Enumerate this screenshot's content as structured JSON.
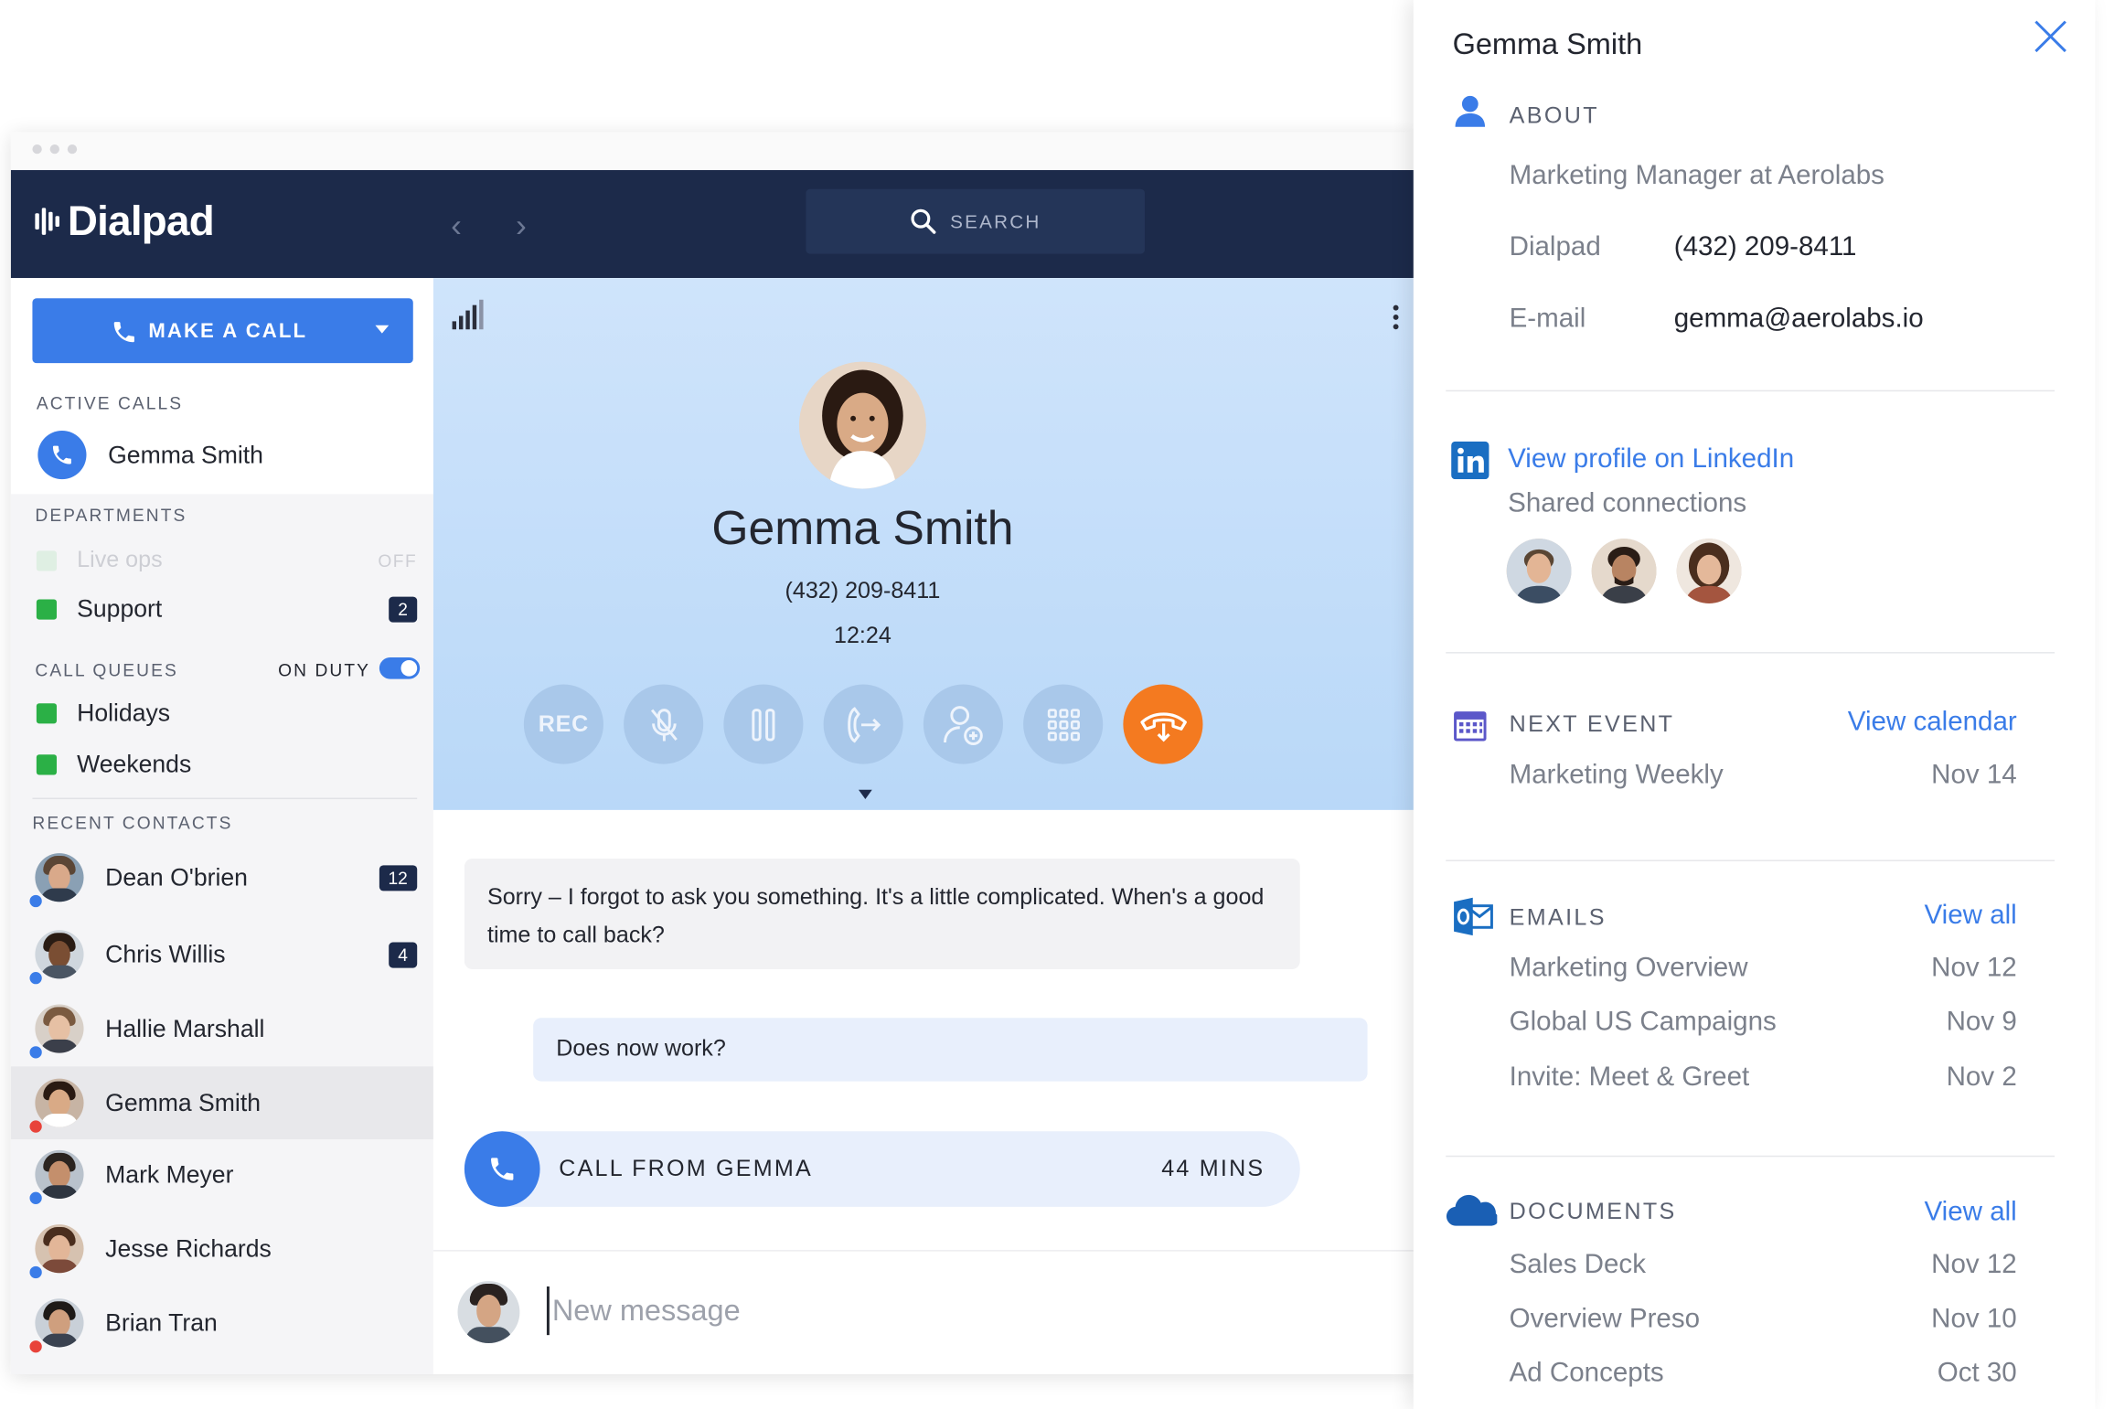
{
  "app": {
    "brand": "Dialpad",
    "search_label": "SEARCH"
  },
  "sidebar": {
    "make_call_label": "MAKE A CALL",
    "active_calls_label": "ACTIVE CALLS",
    "active_call_name": "Gemma Smith",
    "departments_label": "DEPARTMENTS",
    "departments": [
      {
        "name": "Live ops",
        "status": "OFF",
        "color": "#c6e9cc"
      },
      {
        "name": "Support",
        "badge": "2",
        "color": "#2bb046"
      }
    ],
    "call_queues_label": "CALL QUEUES",
    "on_duty_label": "ON DUTY",
    "queues": [
      {
        "name": "Holidays",
        "color": "#2bb046"
      },
      {
        "name": "Weekends",
        "color": "#2bb046"
      }
    ],
    "recent_contacts_label": "RECENT CONTACTS",
    "contacts": [
      {
        "name": "Dean O'brien",
        "badge": "12",
        "presence": "#3a7ce8"
      },
      {
        "name": "Chris Willis",
        "badge": "4",
        "presence": "#3a7ce8"
      },
      {
        "name": "Hallie Marshall",
        "badge": "",
        "presence": "#3a7ce8"
      },
      {
        "name": "Gemma Smith",
        "badge": "",
        "presence": "#e8433a"
      },
      {
        "name": "Mark Meyer",
        "badge": "",
        "presence": "#3a7ce8"
      },
      {
        "name": "Jesse Richards",
        "badge": "",
        "presence": "#3a7ce8"
      },
      {
        "name": "Brian Tran",
        "badge": "",
        "presence": "#e8433a"
      }
    ]
  },
  "call": {
    "name": "Gemma Smith",
    "number": "(432) 209-8411",
    "duration": "12:24",
    "rec_label": "REC",
    "controls": [
      "rec",
      "mute-icon",
      "hold-icon",
      "transfer-icon",
      "add-person-icon",
      "keypad-icon",
      "hangup-icon"
    ]
  },
  "conversation": {
    "message_in": "Sorry – I forgot to ask you something. It's a little complicated. When's a good time to call back?",
    "message_out": "Does now work?",
    "call_record_label": "CALL FROM GEMMA",
    "call_record_duration": "44 MINS",
    "composer_placeholder": "New message"
  },
  "panel": {
    "title": "Gemma Smith",
    "about_label": "ABOUT",
    "job": "Marketing Manager at Aerolabs",
    "dialpad_label": "Dialpad",
    "dialpad_value": "(432) 209-8411",
    "email_label": "E-mail",
    "email_value": "gemma@aerolabs.io",
    "linkedin_link": "View profile on LinkedIn",
    "shared_connections": "Shared connections",
    "next_event_label": "NEXT EVENT",
    "view_calendar": "View calendar",
    "event_name": "Marketing Weekly",
    "event_date": "Nov 14",
    "emails_label": "EMAILS",
    "emails_view_all": "View all",
    "emails": [
      {
        "subject": "Marketing Overview",
        "date": "Nov 12"
      },
      {
        "subject": "Global US Campaigns",
        "date": "Nov 9"
      },
      {
        "subject": "Invite: Meet & Greet",
        "date": "Nov 2"
      }
    ],
    "documents_label": "DOCUMENTS",
    "documents_view_all": "View all",
    "documents": [
      {
        "name": "Sales Deck",
        "date": "Nov 12"
      },
      {
        "name": "Overview Preso",
        "date": "Nov 10"
      },
      {
        "name": "Ad Concepts",
        "date": "Oct 30"
      }
    ]
  },
  "colors": {
    "navy": "#1c2a4a",
    "accent_blue": "#3a7ce8",
    "end_call_orange": "#f47a20",
    "status_green": "#2bb046"
  }
}
